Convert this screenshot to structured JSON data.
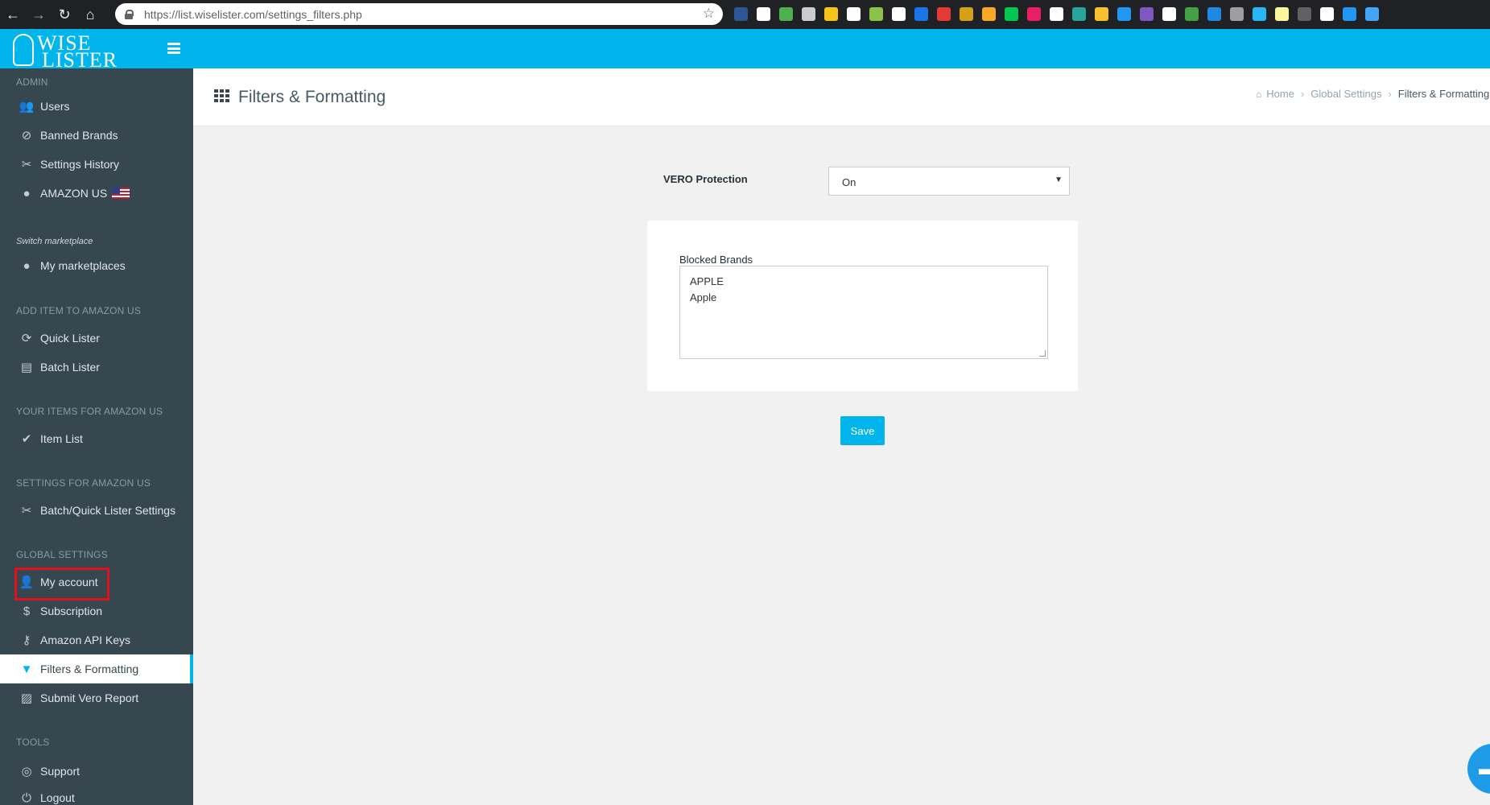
{
  "browser": {
    "back": "←",
    "forward": "→",
    "reload": "↻",
    "home": "⌂",
    "url": "https://list.wiselister.com/settings_filters.php",
    "bookmark_icon": "☆",
    "extension_colors": [
      "#2b5797",
      "#ffffff",
      "#4caf50",
      "#cccccc",
      "#f5c518",
      "#ffffff",
      "#8bc34a",
      "#ffffff",
      "#1a73e8",
      "#e53935",
      "#d4a017",
      "#f9a825",
      "#00c853",
      "#e91e63",
      "#ffffff",
      "#26a69a",
      "#fbc02d",
      "#2196f3",
      "#7e57c2",
      "#ffffff",
      "#43a047",
      "#1e88e5",
      "#9e9e9e",
      "#29b6f6",
      "#fff59d",
      "#616161",
      "#ffffff",
      "#2196f3",
      "#42a5f5"
    ]
  },
  "app": {
    "logo_line1": "WISE",
    "logo_line2": "LISTER"
  },
  "sidebar": {
    "sections": {
      "admin": "ADMIN",
      "add_item": "ADD ITEM TO AMAZON US",
      "your_items": "YOUR ITEMS FOR AMAZON US",
      "settings_for": "SETTINGS FOR AMAZON US",
      "global": "GLOBAL SETTINGS",
      "tools": "TOOLS"
    },
    "items": {
      "users": "Users",
      "banned_brands": "Banned Brands",
      "settings_history": "Settings History",
      "amazon_us": "AMAZON US",
      "switch_hint": "Switch marketplace",
      "my_marketplaces": "My marketplaces",
      "quick_lister": "Quick Lister",
      "batch_lister": "Batch Lister",
      "item_list": "Item List",
      "batch_quick_settings": "Batch/Quick Lister Settings",
      "my_account": "My account",
      "subscription": "Subscription",
      "api_keys": "Amazon API Keys",
      "filters_formatting": "Filters & Formatting",
      "submit_vero": "Submit Vero Report",
      "support": "Support",
      "logout": "Logout"
    }
  },
  "header": {
    "title": "Filters & Formatting",
    "breadcrumb": {
      "home": "Home",
      "global_settings": "Global Settings",
      "current": "Filters & Formatting"
    }
  },
  "form": {
    "vero_label": "VERO Protection",
    "vero_value": "On",
    "blocked_brands_label": "Blocked Brands",
    "blocked_brands": [
      "APPLE",
      "Apple"
    ],
    "save_label": "Save"
  },
  "colors": {
    "accent": "#00b5eb",
    "sidebar_bg": "#37474f",
    "highlight_box": "#e0111b"
  }
}
